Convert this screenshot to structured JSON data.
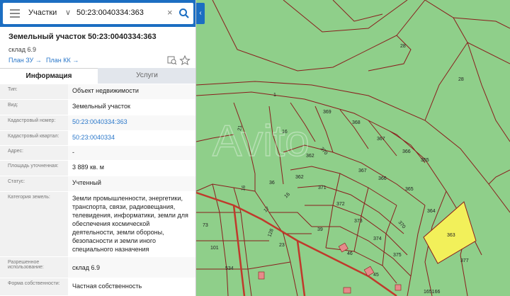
{
  "search": {
    "category_label": "Участки",
    "query_value": "50:23:0040334:363"
  },
  "header": {
    "title": "Земельный участок 50:23:0040334:363",
    "subtitle": "склад 6.9",
    "link_plan_zu": "План ЗУ",
    "link_plan_kk": "План КК"
  },
  "tabs": [
    {
      "label": "Информация"
    },
    {
      "label": "Услуги"
    }
  ],
  "properties": [
    {
      "key": "Тип:",
      "value": "Объект недвижимости"
    },
    {
      "key": "Вид:",
      "value": "Земельный участок"
    },
    {
      "key": "Кадастровый номер:",
      "value": "50:23:0040334:363"
    },
    {
      "key": "Кадастровый квартал:",
      "value": "50:23:0040334"
    },
    {
      "key": "Адрес:",
      "value": "-"
    },
    {
      "key": "Площадь уточненная:",
      "value": "3 889 кв. м"
    },
    {
      "key": "Статус:",
      "value": "Учтенный"
    },
    {
      "key": "Категория земель:",
      "value": "Земли промышленности, энергетики, транспорта, связи, радиовещания, телевидения, информатики, земли для обеспечения космической деятельности, земли обороны, безопасности и земли иного специального назначения"
    },
    {
      "key": "Разрешенное использование:",
      "value": "склад 6.9"
    },
    {
      "key": "Форма собственности:",
      "value": "Частная собственность"
    }
  ],
  "map": {
    "watermark": "Avito",
    "parcel_labels": [
      "1",
      "16",
      "21",
      "28",
      "362",
      "363",
      "364",
      "365",
      "366",
      "367",
      "368",
      "369",
      "370",
      "371",
      "372",
      "373",
      "374",
      "375",
      "377",
      "36",
      "39",
      "45",
      "46",
      "101",
      "128",
      "534",
      "165166",
      "A5",
      "17"
    ],
    "highlighted_parcel": "363",
    "colors": {
      "land": "#8fcf8a",
      "boundary": "#8a1c1c",
      "highlight": "#f2f05a",
      "road": "#c0392b",
      "building": "#e58a8a"
    }
  }
}
